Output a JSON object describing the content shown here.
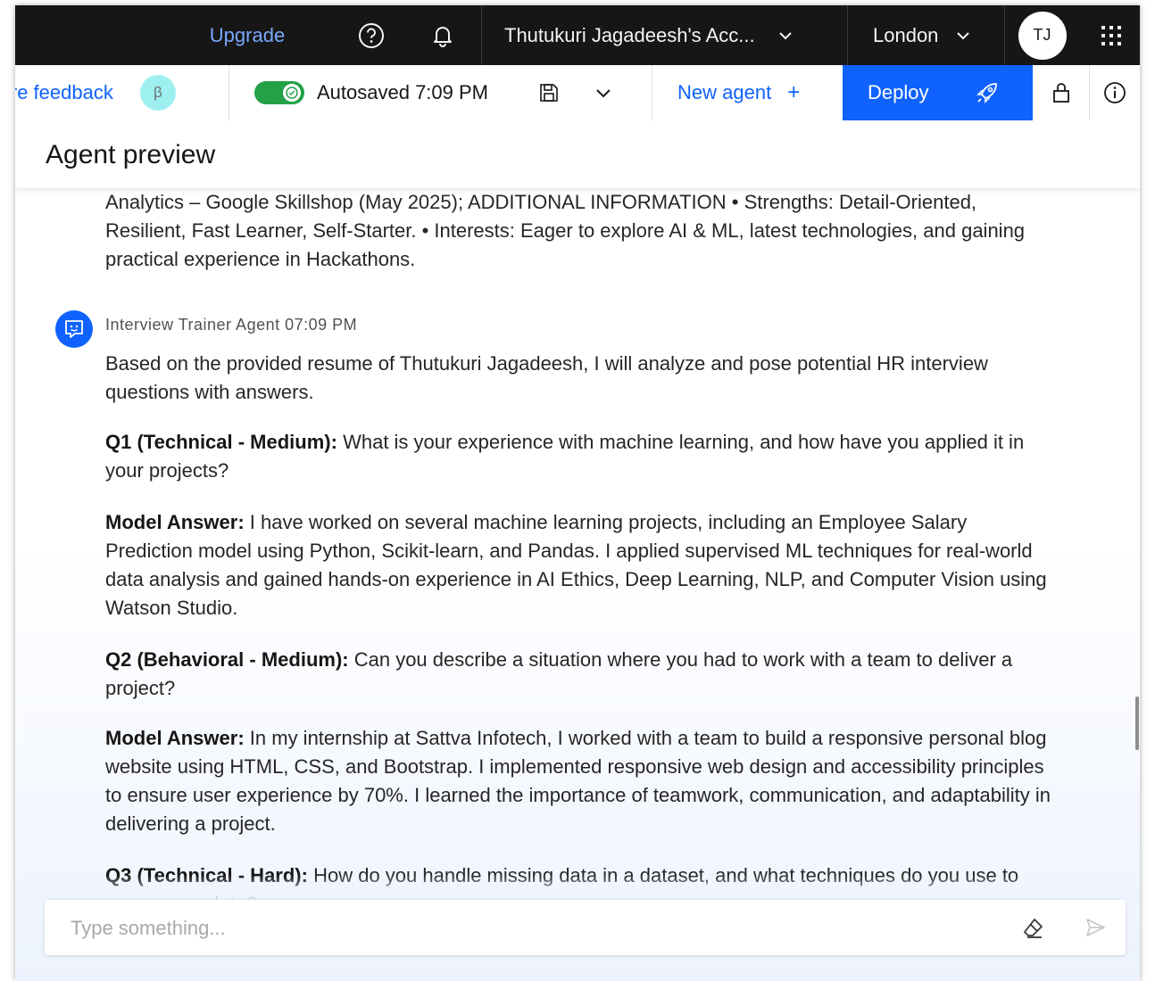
{
  "topbar": {
    "upgrade_label": "Upgrade",
    "account_label": "Thutukuri Jagadeesh's Acc...",
    "region_label": "London",
    "avatar_initials": "TJ"
  },
  "toolbar": {
    "feedback_label": "ire feedback",
    "beta_label": "β",
    "autosave_label": "Autosaved 7:09 PM",
    "new_agent_label": "New agent",
    "new_agent_plus": "+",
    "deploy_label": "Deploy"
  },
  "panel": {
    "title": "Agent preview"
  },
  "chat": {
    "user_message_tail": "Analytics – Google Skillshop (May 2025); ADDITIONAL INFORMATION • Strengths: Detail-Oriented, Resilient, Fast Learner, Self-Starter. • Interests: Eager to explore AI & ML, latest technologies, and gaining practical experience in Hackathons.",
    "agent_name": "Interview Trainer Agent",
    "agent_time": "07:09 PM",
    "intro": "Based on the provided resume of Thutukuri Jagadeesh, I will analyze and pose potential HR interview questions with answers.",
    "items": [
      {
        "label": "Q1 (Technical - Medium):",
        "text": "What is your experience with machine learning, and how have you applied it in your projects?"
      },
      {
        "label": "Model Answer:",
        "text": "I have worked on several machine learning projects, including an Employee Salary Prediction model using Python, Scikit-learn, and Pandas. I applied supervised ML techniques for real-world data analysis and gained hands-on experience in AI Ethics, Deep Learning, NLP, and Computer Vision using Watson Studio."
      },
      {
        "label": "Q2 (Behavioral - Medium):",
        "text": "Can you describe a situation where you had to work with a team to deliver a project?"
      },
      {
        "label": "Model Answer:",
        "text": "In my internship at Sattva Infotech, I worked with a team to build a responsive personal blog website using HTML, CSS, and Bootstrap. I implemented responsive web design and accessibility principles to ensure user experience by 70%. I learned the importance of teamwork, communication, and adaptability in delivering a project."
      },
      {
        "label": "Q3 (Technical - Hard):",
        "text": "How do you handle missing data in a dataset, and what techniques do you use to preprocess data?"
      }
    ]
  },
  "composer": {
    "placeholder": "Type something..."
  },
  "colors": {
    "topbar_bg": "#161616",
    "accent_blue": "#0f62fe",
    "link_blue": "#78a9ff",
    "toggle_green": "#24a148",
    "beta_bg": "#9ef0f0"
  },
  "icons": [
    "help-icon",
    "bell-icon",
    "chevron-down-icon",
    "apps-grid-icon",
    "check-icon",
    "save-icon",
    "rocket-icon",
    "lock-icon",
    "info-icon",
    "agent-chat-icon",
    "eraser-icon",
    "send-icon"
  ]
}
